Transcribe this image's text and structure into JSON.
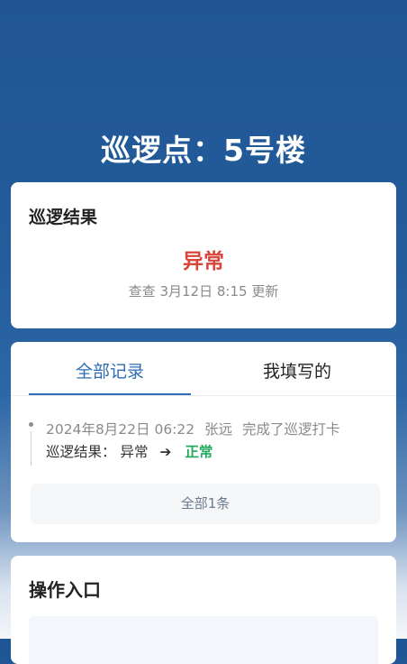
{
  "page": {
    "title": "巡逻点：5号楼"
  },
  "result_card": {
    "title": "巡逻结果",
    "status": "异常",
    "updated_prefix": "查查",
    "updated_time": "3月12日 8:15",
    "updated_suffix": "更新"
  },
  "records_card": {
    "tabs": [
      {
        "label": "全部记录",
        "active": true
      },
      {
        "label": "我填写的",
        "active": false
      }
    ],
    "records": [
      {
        "datetime": "2024年8月22日 06:22",
        "user": "张远",
        "action": "完成了巡逻打卡",
        "result_label": "巡逻结果：",
        "old_value": "异常",
        "new_value": "正常"
      }
    ],
    "more_label": "全部1条"
  },
  "ops_card": {
    "title": "操作入口"
  },
  "colors": {
    "accent": "#2e6db4",
    "abnormal": "#d9453a",
    "normal": "#22a95b"
  },
  "icons": {
    "arrow": "arrow-right-icon",
    "timeline_dot": "timeline-dot-icon"
  }
}
